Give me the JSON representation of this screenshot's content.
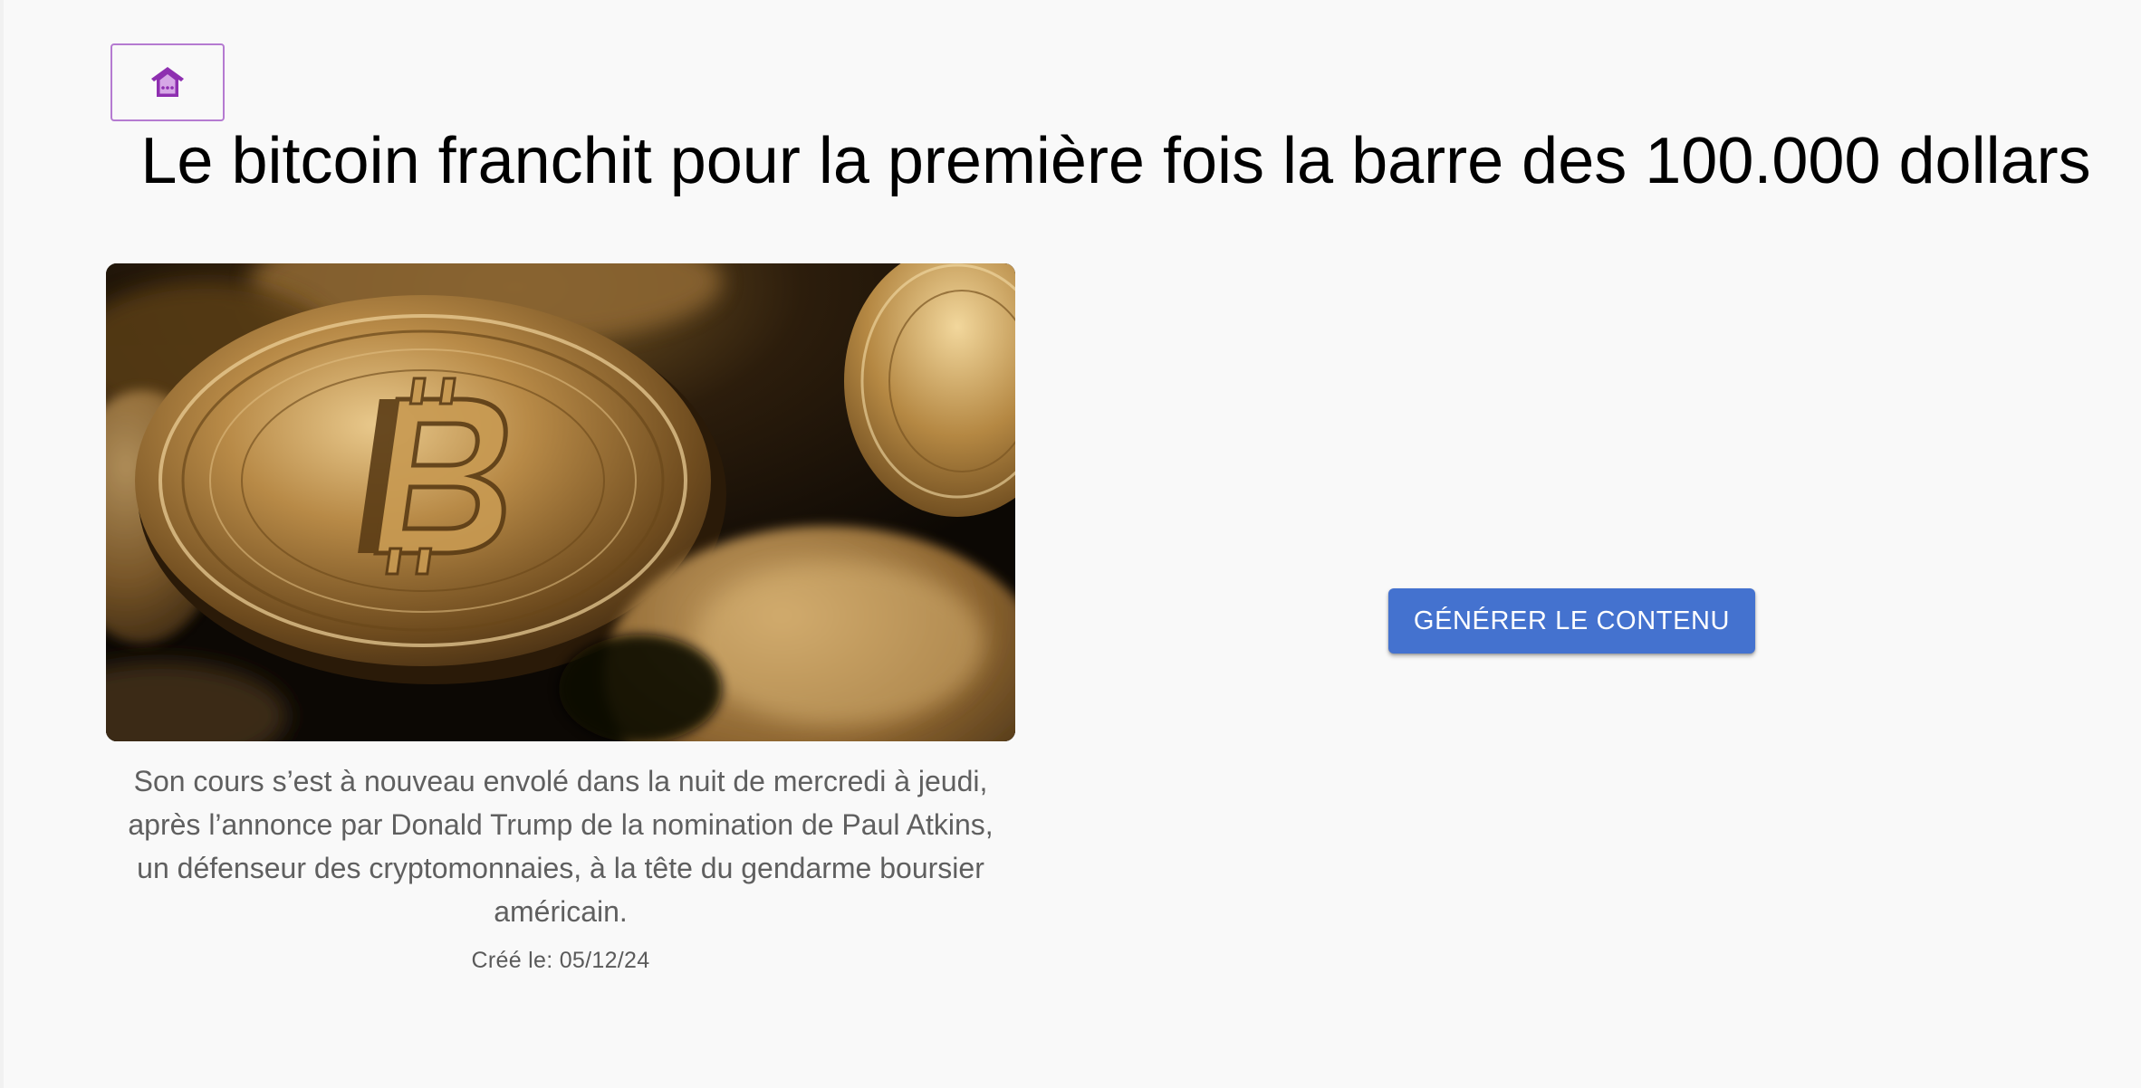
{
  "header": {
    "home_icon": "home-icon",
    "title": "Le bitcoin franchit pour la première fois la barre des 100.000 dollars"
  },
  "article": {
    "image_description": "bitcoin-coins-photo",
    "summary": "Son cours s’est à nouveau envolé dans la nuit de mercredi à jeudi, après l’annonce par Donald Trump de la nomination de Paul Atkins, un défenseur des cryptomonnaies, à la tête du gendarme boursier américain.",
    "created_label": "Créé le: 05/12/24"
  },
  "actions": {
    "generate_label": "Générer le contenu"
  },
  "colors": {
    "background": "#f9f9f9",
    "accent_purple": "#8e2fb0",
    "button_blue": "#4472cf",
    "summary_text": "#5f5f5f"
  }
}
